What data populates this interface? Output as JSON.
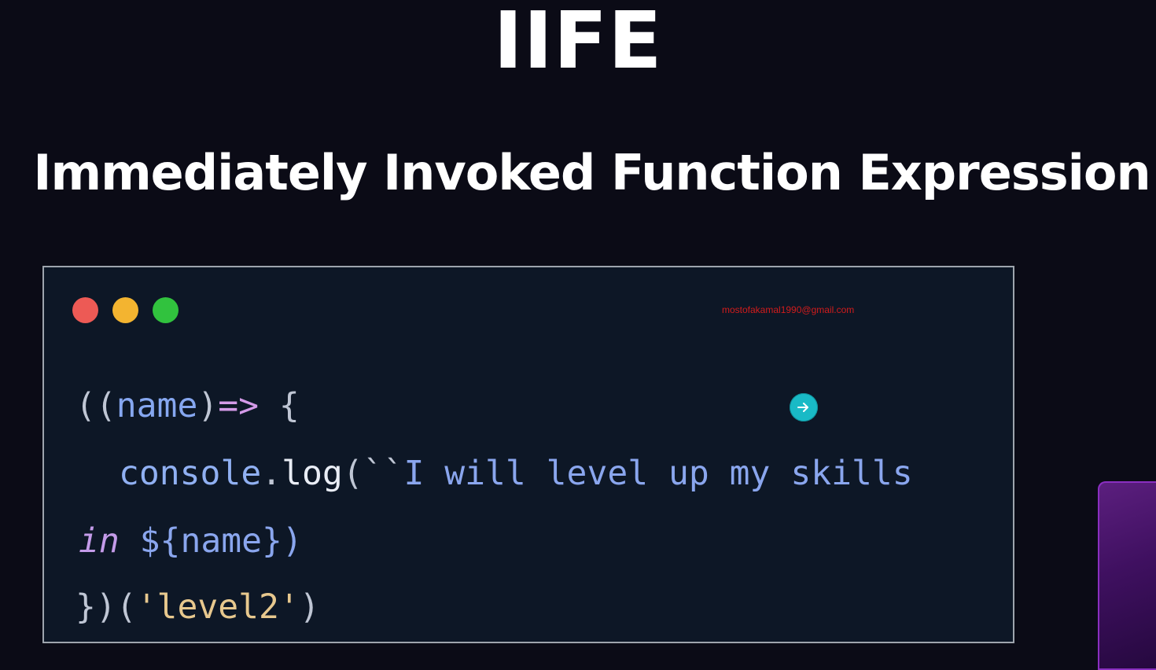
{
  "slide": {
    "title": "IIFE",
    "subtitle": "Immediately Invoked Function Expression"
  },
  "code_window": {
    "window_controls": [
      "close-dot",
      "minimize-dot",
      "maximize-dot"
    ],
    "watermark": "mostofakamal1990@gmail.com",
    "code": {
      "line1": {
        "open": "((",
        "param": "name",
        "close_paren": ")",
        "arrow": "=>",
        "brace": " {"
      },
      "line2": {
        "object": "console",
        "dot": ".",
        "method": "log",
        "open_paren": "(",
        "backticks": "``",
        "text": "I will level up my skills"
      },
      "line3": {
        "keyword": "in",
        "template_open": " ${",
        "variable": "name",
        "template_close": "})",
        "close_paren": ")"
      },
      "line4": {
        "close": "})(",
        "argument": "'level2'",
        "end": ")"
      }
    }
  },
  "colors": {
    "background": "#0b0b16",
    "code_background": "#0d1726",
    "close_dot": "#ed5a55",
    "minimize_dot": "#f3b430",
    "maximize_dot": "#31c23e",
    "cursor_indicator": "#19bac6",
    "watermark": "#d21c1c"
  },
  "icons": {
    "cursor_indicator": "arrow-right-icon"
  }
}
